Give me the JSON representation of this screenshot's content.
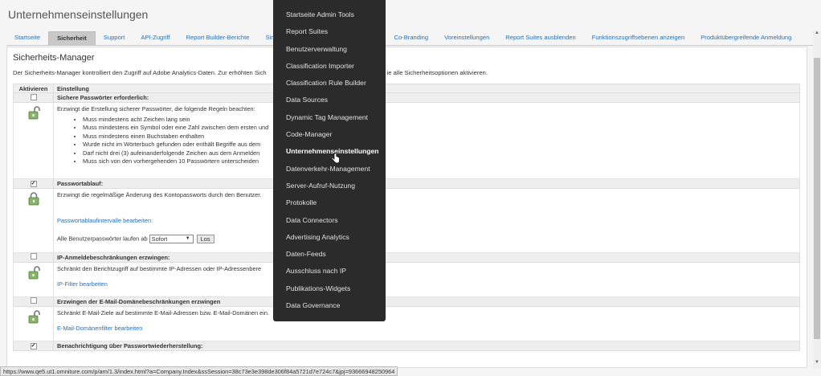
{
  "page": {
    "title": "Unternehmenseinstellungen"
  },
  "tabs": [
    {
      "label": "Startseite"
    },
    {
      "label": "Sicherheit",
      "active": true
    },
    {
      "label": "Support"
    },
    {
      "label": "API-Zugriff"
    },
    {
      "label": "Report Builder-Berichte"
    },
    {
      "label": "Sing"
    },
    {
      "label": "Co-Branding"
    },
    {
      "label": "Voreinstellungen"
    },
    {
      "label": "Report Suites ausblenden"
    },
    {
      "label": "Funktionszugriffsebenen anzeigen"
    },
    {
      "label": "Produktübergreifende Anmeldung"
    }
  ],
  "panel": {
    "title": "Sicherheits-Manager",
    "intro": "Der Sicherheits-Manager kontrolliert den Zugriff auf Adobe Analytics-Daten. Zur erhöhten Sich",
    "intro_tail": "ie alle Sicherheitsoptionen aktivieren."
  },
  "table": {
    "col_activate": "Aktivieren",
    "col_setting": "Einstellung",
    "sections": [
      {
        "title": "Sichere Passwörter erforderlich:",
        "checked": false,
        "intro": "Erzwingt die Erstellung sicherer Passwörter, die folgende Regeln beachten:",
        "rules": [
          "Muss mindestens acht Zeichen lang sein",
          "Muss mindestens ein Symbol oder eine Zahl zwischen dem ersten und",
          "Muss mindestens einen Buchstaben enthalten",
          "Wurde nicht im Wörterbuch gefunden oder enthält Begriffe aus dem",
          "Darf nicht drei (3) aufeinanderfolgende Zeichen aus dem Anmelden",
          "Muss sich von den vorhergehenden 10 Passwörtern unterscheiden"
        ]
      },
      {
        "title": "Passwortablauf:",
        "checked": true,
        "text": "Erzwingt die regelmäßige Änderung des Kontopassworts durch den Benutzer.",
        "link": "Passwortablaufintervalle bearbeiten:",
        "expire_label": "Alle Benutzerpasswörter laufen ab",
        "expire_value": "Sofort",
        "button": "Los"
      },
      {
        "title": "IP-Anmeldebeschränkungen erzwingen:",
        "checked": false,
        "text": "Schränkt den Berichtzugriff auf bestimmte IP-Adressen oder IP-Adressenbere",
        "link": "IP-Filter bearbeiten"
      },
      {
        "title": "Erzwingen der E-Mail-Domänebeschränkungen erzwingen",
        "checked": false,
        "text": "Schränkt E-Mail-Ziele auf bestimmte E-Mail-Adressen bzw. E-Mail-Domänen ein.",
        "link": "E-Mail-Domänenfilter bearbeiten"
      },
      {
        "title": "Benachrichtigung über Passwortwiederherstellung:",
        "checked": true
      }
    ]
  },
  "menu": {
    "items": [
      {
        "label": "Startseite Admin Tools"
      },
      {
        "label": "Report Suites"
      },
      {
        "label": "Benutzerverwaltung"
      },
      {
        "label": "Classification Importer"
      },
      {
        "label": "Classification Rule Builder"
      },
      {
        "label": "Data Sources"
      },
      {
        "label": "Dynamic Tag Management"
      },
      {
        "label": "Code-Manager"
      },
      {
        "label": "Unternehmenseinstellungen",
        "highlight": true
      },
      {
        "label": "Datenverkehr-Management"
      },
      {
        "label": "Server-Aufruf-Nutzung"
      },
      {
        "label": "Protokolle"
      },
      {
        "label": "Data Connectors"
      },
      {
        "label": "Advertising Analytics"
      },
      {
        "label": "Daten-Feeds"
      },
      {
        "label": "Ausschluss nach IP"
      },
      {
        "label": "Publikations-Widgets"
      },
      {
        "label": "Data Governance"
      }
    ]
  },
  "statusbar": {
    "url": "https://www.qe5.ut1.omniture.com/p/am/1.3/index.html?a=Company.Index&ssSession=38c73e3e398de306f84a5721d7e724c7&jpj=93666948250964"
  },
  "colors": {
    "link": "#2a6fb5",
    "menu_bg": "#2b2b2b",
    "active_tab": "#c9c9c9"
  }
}
